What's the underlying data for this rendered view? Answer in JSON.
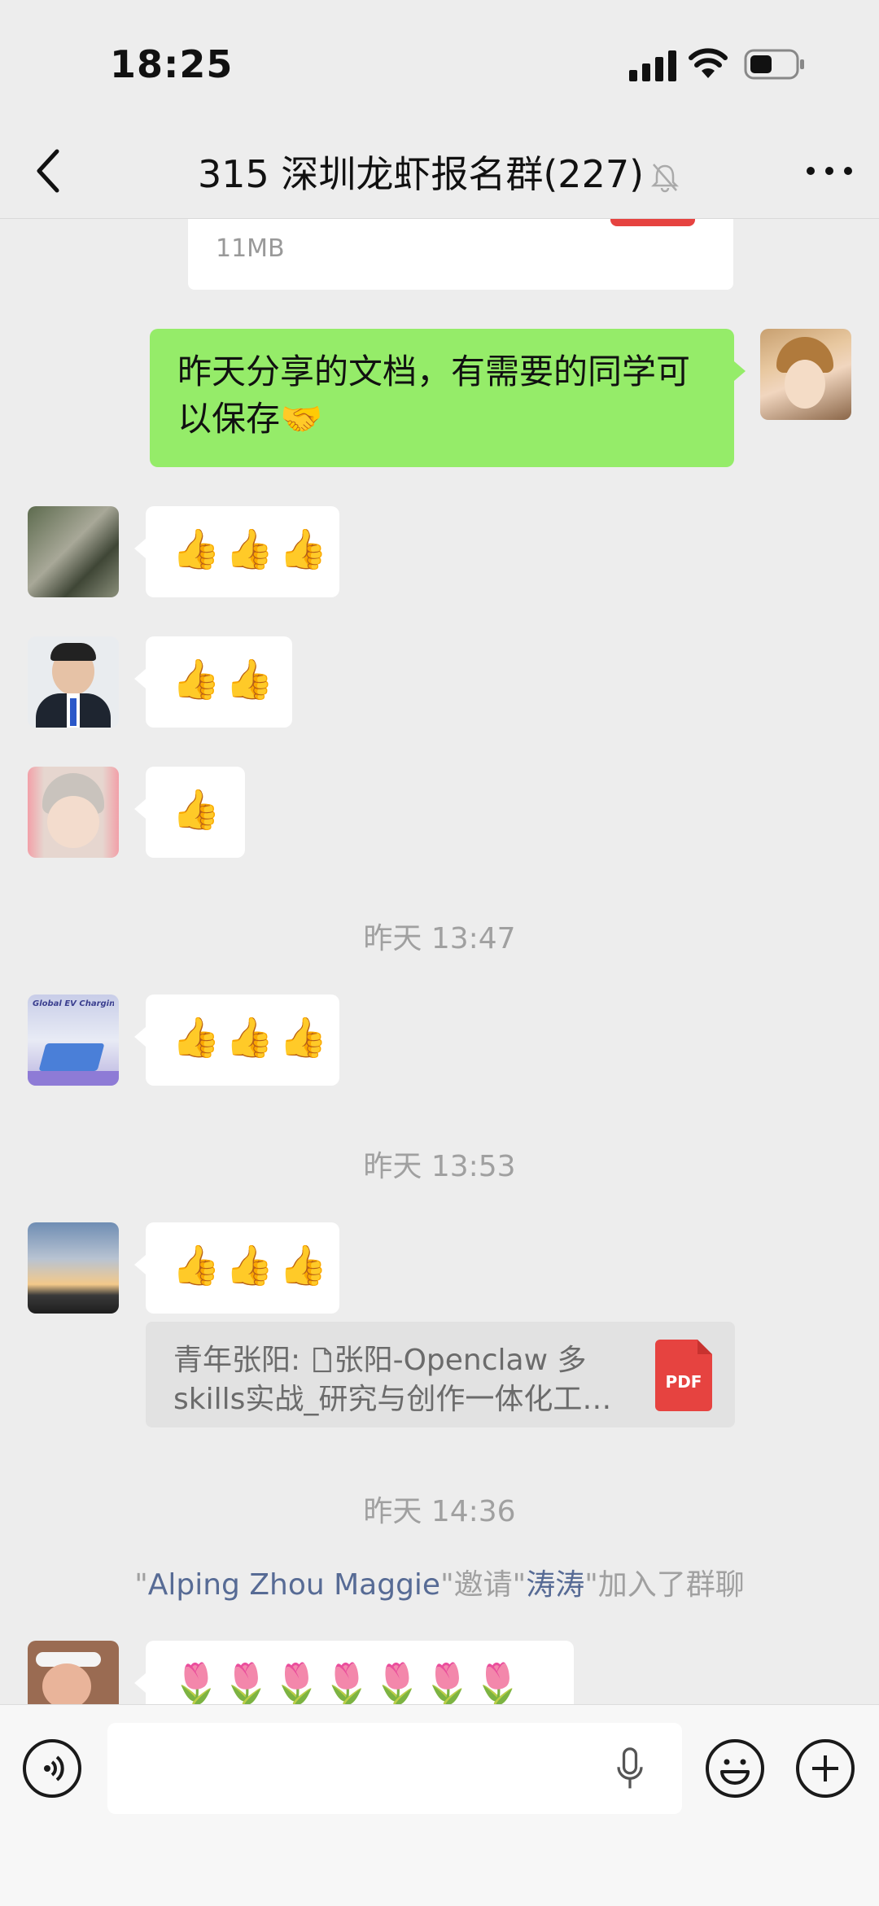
{
  "status_bar": {
    "time": "18:25"
  },
  "header": {
    "title": "315 深圳龙虾报名群(227)"
  },
  "file_card_top": {
    "size": "11MB"
  },
  "messages": {
    "own_text": "昨天分享的文档，有需要的同学可以保存🤝",
    "thumbs_three": "👍👍👍",
    "thumbs_two": "👍👍",
    "thumbs_one": "👍",
    "ev_avatar_caption": "Global EV Charging Stations",
    "tulips": "🌷🌷🌷🌷🌷🌷🌷🌷"
  },
  "timestamps": [
    "昨天 13:47",
    "昨天 13:53",
    "昨天 14:36"
  ],
  "quote": {
    "author": "青年张阳:",
    "line1": "张阳-Openclaw 多",
    "line2": "skills实战_研究与创作一体化工…",
    "badge": "PDF"
  },
  "system": {
    "q1": "\"",
    "inviter": "Alping Zhou Maggie",
    "mid": "\"邀请\"",
    "invitee": "涛涛",
    "end": "\"加入了群聊"
  },
  "colors": {
    "background": "#ededed",
    "own_bubble": "#95ec69",
    "link": "#576b95",
    "pdf_red": "#e64340"
  },
  "icons": [
    "back-icon",
    "mute-bell-icon",
    "more-icon",
    "voice-icon",
    "mic-icon",
    "emoji-icon",
    "plus-icon",
    "pdf-icon",
    "file-icon"
  ]
}
